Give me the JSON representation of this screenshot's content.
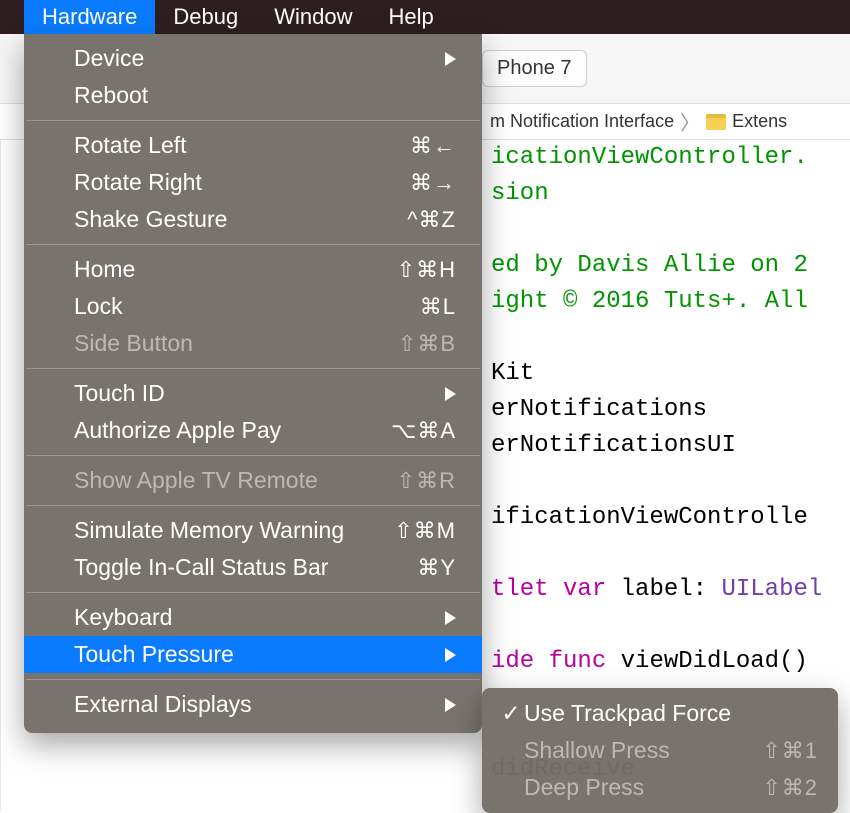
{
  "menubar": {
    "items": [
      "Hardware",
      "Debug",
      "Window",
      "Help"
    ],
    "active_index": 0
  },
  "toolbar": {
    "device": "Phone 7"
  },
  "breadcrumb": {
    "part1": "m Notification Interface",
    "part2": "Extens"
  },
  "code": {
    "l1": "icationViewController.",
    "l2": "sion",
    "l3": "ed by Davis Allie on 2",
    "l4": "ight © 2016 Tuts+. All",
    "l5": "Kit",
    "l6": "erNotifications",
    "l7": "erNotificationsUI",
    "l8": "ificationViewControlle",
    "l9a": "tlet",
    "l9b": "var",
    "l9c": "label:",
    "l9d": "UILabel",
    "l10a": "ide",
    "l10b": "func",
    "l10c": "viewDidLoad()",
    "l11a": "didReceive"
  },
  "menu": {
    "items": [
      {
        "label": "Device",
        "shortcut": "",
        "arrow": true
      },
      {
        "label": "Reboot"
      },
      {
        "sep": true
      },
      {
        "label": "Rotate Left",
        "shortcut": "⌘←"
      },
      {
        "label": "Rotate Right",
        "shortcut": "⌘→"
      },
      {
        "label": "Shake Gesture",
        "shortcut": "^⌘Z"
      },
      {
        "sep": true
      },
      {
        "label": "Home",
        "shortcut": "⇧⌘H"
      },
      {
        "label": "Lock",
        "shortcut": "⌘L"
      },
      {
        "label": "Side Button",
        "shortcut": "⇧⌘B",
        "disabled": true
      },
      {
        "sep": true
      },
      {
        "label": "Touch ID",
        "arrow": true
      },
      {
        "label": "Authorize Apple Pay",
        "shortcut": "⌥⌘A"
      },
      {
        "sep": true
      },
      {
        "label": "Show Apple TV Remote",
        "shortcut": "⇧⌘R",
        "disabled": true
      },
      {
        "sep": true
      },
      {
        "label": "Simulate Memory Warning",
        "shortcut": "⇧⌘M"
      },
      {
        "label": "Toggle In-Call Status Bar",
        "shortcut": "⌘Y"
      },
      {
        "sep": true
      },
      {
        "label": "Keyboard",
        "arrow": true
      },
      {
        "label": "Touch Pressure",
        "arrow": true,
        "highlighted": true
      },
      {
        "sep": true
      },
      {
        "label": "External Displays",
        "arrow": true
      }
    ]
  },
  "submenu": {
    "items": [
      {
        "label": "Use Trackpad Force",
        "checked": true
      },
      {
        "label": "Shallow Press",
        "shortcut": "⇧⌘1",
        "disabled": true
      },
      {
        "label": "Deep Press",
        "shortcut": "⇧⌘2",
        "disabled": true
      }
    ]
  }
}
